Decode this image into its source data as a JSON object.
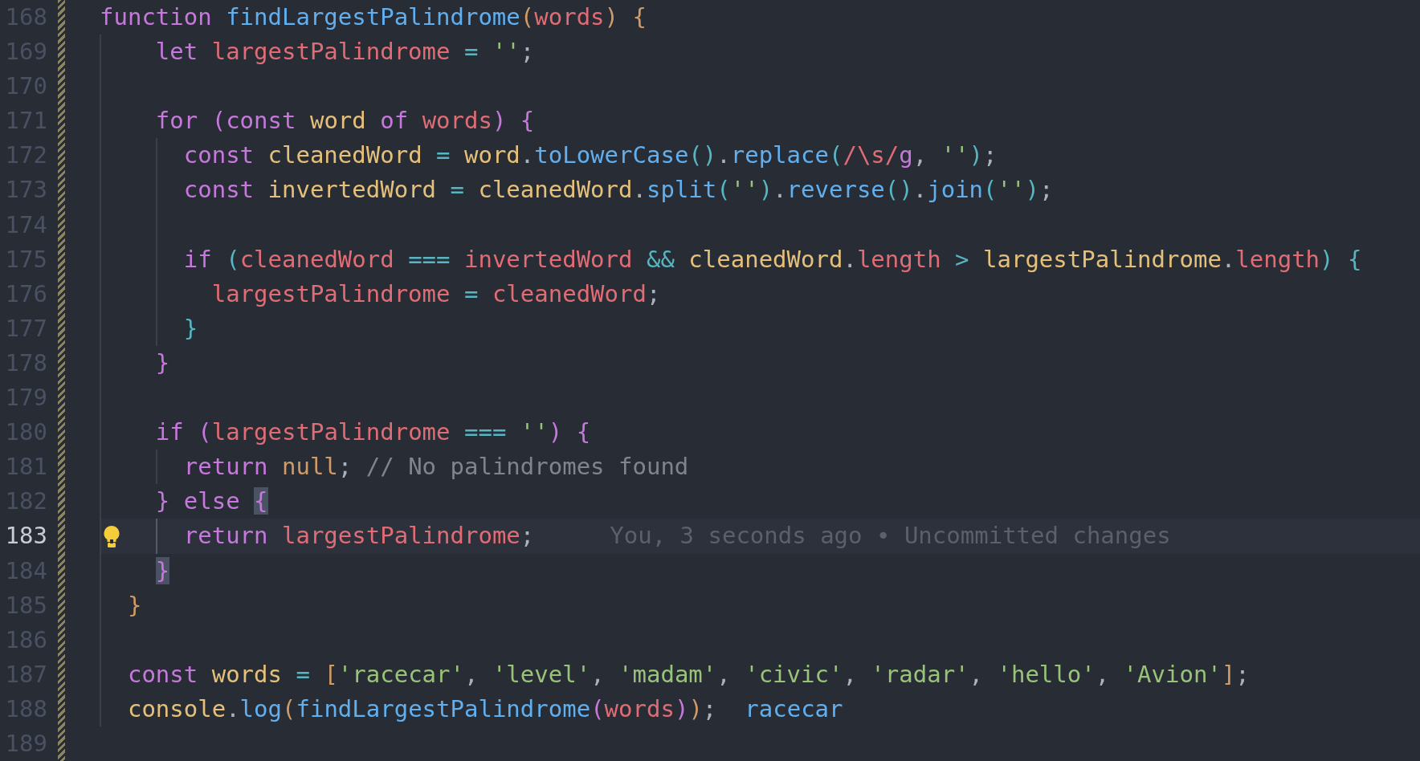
{
  "editor": {
    "lines": [
      {
        "number": "168",
        "current": false,
        "tokens": [
          {
            "kind": "kw",
            "text": "function "
          },
          {
            "kind": "fn",
            "text": "findLargestPalindrome"
          },
          {
            "kind": "b1",
            "text": "("
          },
          {
            "kind": "var",
            "text": "words"
          },
          {
            "kind": "b1",
            "text": ") "
          },
          {
            "kind": "b1",
            "text": "{"
          }
        ]
      },
      {
        "number": "169",
        "current": false,
        "tokens": [
          {
            "kind": "kw",
            "text": "    let "
          },
          {
            "kind": "var",
            "text": "largestPalindrome "
          },
          {
            "kind": "op",
            "text": "= "
          },
          {
            "kind": "str",
            "text": "''"
          },
          {
            "kind": "p",
            "text": ";"
          }
        ]
      },
      {
        "number": "170",
        "current": false
      },
      {
        "number": "171",
        "current": false,
        "tokens": [
          {
            "kind": "kw",
            "text": "    for "
          },
          {
            "kind": "b2",
            "text": "("
          },
          {
            "kind": "kw",
            "text": "const "
          },
          {
            "kind": "name",
            "text": "word "
          },
          {
            "kind": "kw",
            "text": "of "
          },
          {
            "kind": "var",
            "text": "words"
          },
          {
            "kind": "b2",
            "text": ") "
          },
          {
            "kind": "b2",
            "text": "{"
          }
        ]
      },
      {
        "number": "172",
        "current": false,
        "tokens": [
          {
            "kind": "kw",
            "text": "      const "
          },
          {
            "kind": "name",
            "text": "cleanedWord "
          },
          {
            "kind": "op",
            "text": "= "
          },
          {
            "kind": "name",
            "text": "word"
          },
          {
            "kind": "p",
            "text": "."
          },
          {
            "kind": "fn",
            "text": "toLowerCase"
          },
          {
            "kind": "b3",
            "text": "()"
          },
          {
            "kind": "p",
            "text": "."
          },
          {
            "kind": "fn",
            "text": "replace"
          },
          {
            "kind": "b3",
            "text": "("
          },
          {
            "kind": "var",
            "text": "/\\s/"
          },
          {
            "kind": "kw",
            "text": "g"
          },
          {
            "kind": "p",
            "text": ", "
          },
          {
            "kind": "str",
            "text": "''"
          },
          {
            "kind": "b3",
            "text": ")"
          },
          {
            "kind": "p",
            "text": ";"
          }
        ]
      },
      {
        "number": "173",
        "current": false,
        "tokens": [
          {
            "kind": "kw",
            "text": "      const "
          },
          {
            "kind": "name",
            "text": "invertedWord "
          },
          {
            "kind": "op",
            "text": "= "
          },
          {
            "kind": "name",
            "text": "cleanedWord"
          },
          {
            "kind": "p",
            "text": "."
          },
          {
            "kind": "fn",
            "text": "split"
          },
          {
            "kind": "b3",
            "text": "("
          },
          {
            "kind": "str",
            "text": "''"
          },
          {
            "kind": "b3",
            "text": ")"
          },
          {
            "kind": "p",
            "text": "."
          },
          {
            "kind": "fn",
            "text": "reverse"
          },
          {
            "kind": "b3",
            "text": "()"
          },
          {
            "kind": "p",
            "text": "."
          },
          {
            "kind": "fn",
            "text": "join"
          },
          {
            "kind": "b3",
            "text": "("
          },
          {
            "kind": "str",
            "text": "''"
          },
          {
            "kind": "b3",
            "text": ")"
          },
          {
            "kind": "p",
            "text": ";"
          }
        ]
      },
      {
        "number": "174",
        "current": false
      },
      {
        "number": "175",
        "current": false,
        "tokens": [
          {
            "kind": "kw",
            "text": "      if "
          },
          {
            "kind": "b3",
            "text": "("
          },
          {
            "kind": "var",
            "text": "cleanedWord "
          },
          {
            "kind": "op",
            "text": "=== "
          },
          {
            "kind": "var",
            "text": "invertedWord "
          },
          {
            "kind": "op",
            "text": "&& "
          },
          {
            "kind": "name",
            "text": "cleanedWord"
          },
          {
            "kind": "p",
            "text": "."
          },
          {
            "kind": "var",
            "text": "length "
          },
          {
            "kind": "op",
            "text": "> "
          },
          {
            "kind": "name",
            "text": "largestPalindrome"
          },
          {
            "kind": "p",
            "text": "."
          },
          {
            "kind": "var",
            "text": "length"
          },
          {
            "kind": "b3",
            "text": ") "
          },
          {
            "kind": "b3",
            "text": "{"
          }
        ]
      },
      {
        "number": "176",
        "current": false,
        "tokens": [
          {
            "kind": "var",
            "text": "        largestPalindrome "
          },
          {
            "kind": "op",
            "text": "= "
          },
          {
            "kind": "var",
            "text": "cleanedWord"
          },
          {
            "kind": "p",
            "text": ";"
          }
        ]
      },
      {
        "number": "177",
        "current": false,
        "tokens": [
          {
            "kind": "b3",
            "text": "      }"
          }
        ]
      },
      {
        "number": "178",
        "current": false,
        "tokens": [
          {
            "kind": "b2",
            "text": "    }"
          }
        ]
      },
      {
        "number": "179",
        "current": false
      },
      {
        "number": "180",
        "current": false,
        "tokens": [
          {
            "kind": "kw",
            "text": "    if "
          },
          {
            "kind": "b2",
            "text": "("
          },
          {
            "kind": "var",
            "text": "largestPalindrome "
          },
          {
            "kind": "op",
            "text": "=== "
          },
          {
            "kind": "str",
            "text": "''"
          },
          {
            "kind": "b2",
            "text": ") "
          },
          {
            "kind": "b2",
            "text": "{"
          }
        ]
      },
      {
        "number": "181",
        "current": false,
        "tokens": [
          {
            "kind": "kw",
            "text": "      return "
          },
          {
            "kind": "lit",
            "text": "null"
          },
          {
            "kind": "p",
            "text": "; "
          },
          {
            "kind": "cm",
            "text": "// No palindromes found"
          }
        ]
      },
      {
        "number": "182",
        "current": false,
        "tokens": [
          {
            "kind": "b2",
            "text": "    } "
          },
          {
            "kind": "kw",
            "text": "else "
          },
          {
            "kind": "match2",
            "text": "{"
          }
        ]
      },
      {
        "number": "183",
        "current": true,
        "lightbulb": true,
        "tokens": [
          {
            "kind": "kw",
            "text": "      return "
          },
          {
            "kind": "var",
            "text": "largestPalindrome"
          },
          {
            "kind": "p",
            "text": ";"
          }
        ],
        "blame": "You, 3 seconds ago • Uncommitted changes"
      },
      {
        "number": "184",
        "current": false,
        "tokens": [
          {
            "kind": "match2",
            "text": "    }"
          }
        ]
      },
      {
        "number": "185",
        "current": false,
        "tokens": [
          {
            "kind": "b1",
            "text": "  }"
          }
        ]
      },
      {
        "number": "186",
        "current": false
      },
      {
        "number": "187",
        "current": false,
        "tokens": [
          {
            "kind": "kw",
            "text": "  const "
          },
          {
            "kind": "name",
            "text": "words "
          },
          {
            "kind": "op",
            "text": "= "
          },
          {
            "kind": "b1",
            "text": "["
          },
          {
            "kind": "str",
            "text": "'racecar'"
          },
          {
            "kind": "p",
            "text": ", "
          },
          {
            "kind": "str",
            "text": "'level'"
          },
          {
            "kind": "p",
            "text": ", "
          },
          {
            "kind": "str",
            "text": "'madam'"
          },
          {
            "kind": "p",
            "text": ", "
          },
          {
            "kind": "str",
            "text": "'civic'"
          },
          {
            "kind": "p",
            "text": ", "
          },
          {
            "kind": "str",
            "text": "'radar'"
          },
          {
            "kind": "p",
            "text": ", "
          },
          {
            "kind": "str",
            "text": "'hello'"
          },
          {
            "kind": "p",
            "text": ", "
          },
          {
            "kind": "str",
            "text": "'Avion'"
          },
          {
            "kind": "b1",
            "text": "]"
          },
          {
            "kind": "p",
            "text": ";"
          }
        ]
      },
      {
        "number": "188",
        "current": false,
        "tokens": [
          {
            "kind": "name",
            "text": "  console"
          },
          {
            "kind": "p",
            "text": "."
          },
          {
            "kind": "fn",
            "text": "log"
          },
          {
            "kind": "b1",
            "text": "("
          },
          {
            "kind": "fn",
            "text": "findLargestPalindrome"
          },
          {
            "kind": "b2",
            "text": "("
          },
          {
            "kind": "var",
            "text": "words"
          },
          {
            "kind": "b2",
            "text": ")"
          },
          {
            "kind": "b1",
            "text": ")"
          },
          {
            "kind": "p",
            "text": ";"
          }
        ],
        "result": "racecar"
      },
      {
        "number": "189",
        "current": false
      }
    ]
  }
}
